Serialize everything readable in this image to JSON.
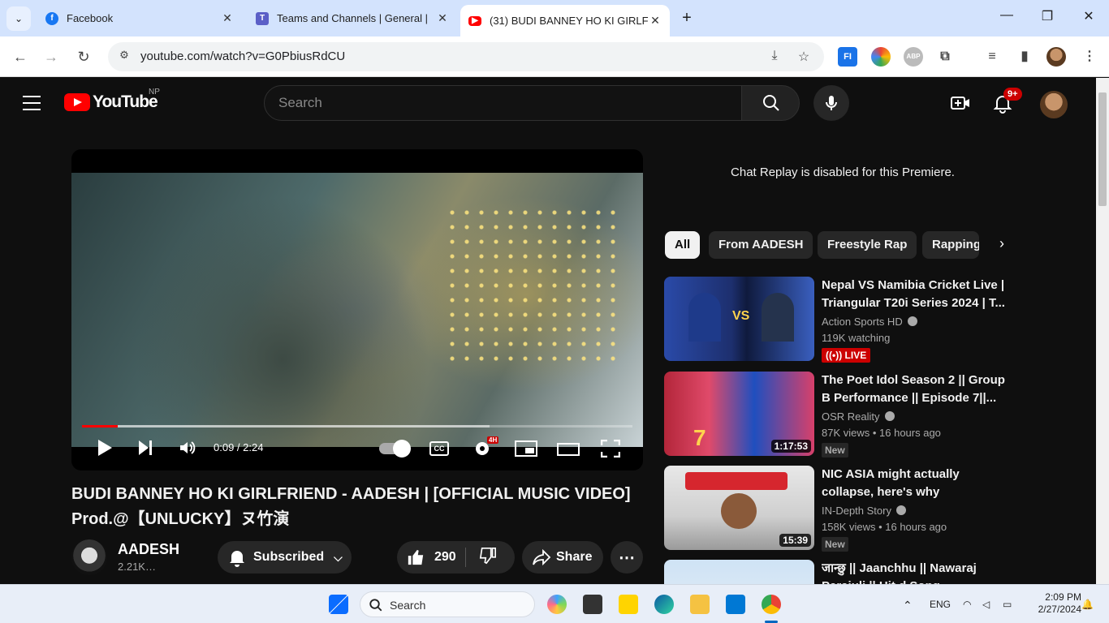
{
  "browser": {
    "tabs": [
      {
        "title": "Facebook",
        "favicon_color": "#1877f2"
      },
      {
        "title": "Teams and Channels | General |",
        "favicon_color": "#5b5fc7"
      },
      {
        "title": "(31) BUDI BANNEY HO KI GIRLF",
        "favicon_color": "#ff0000"
      }
    ],
    "url": "youtube.com/watch?v=G0PbiusRdCU",
    "extensions": [
      "FI",
      "ABP"
    ]
  },
  "yt": {
    "logo_text": "YouTube",
    "region": "NP",
    "search_placeholder": "Search",
    "notif_count": "9+",
    "accent": "#ff0000"
  },
  "player": {
    "time": "0:09 / 2:24",
    "quality_badge": "4H",
    "progress_fraction": 0.065,
    "buffered_fraction": 0.74
  },
  "video": {
    "title": "BUDI BANNEY HO KI GIRLFRIEND - AADESH | [OFFICIAL MUSIC VIDEO] Prod.@【UNLUCKY】ヌ竹演",
    "channel": "AADESH",
    "subs": "2.21K…",
    "subscribed_label": "Subscribed",
    "likes": "290",
    "share_label": "Share"
  },
  "sidebar": {
    "chat_replay": "Chat Replay is disabled for this Premiere.",
    "chips": [
      "All",
      "From AADESH",
      "Freestyle Rap",
      "Rapping"
    ],
    "recs": [
      {
        "title": "Nepal VS Namibia Cricket Live | Triangular T20i Series 2024 | T...",
        "channel": "Action Sports HD",
        "meta": "119K watching",
        "badge": "LIVE",
        "duration": ""
      },
      {
        "title": "The Poet Idol Season 2 || Group B Performance || Episode 7||...",
        "channel": "OSR Reality",
        "meta": "87K views • 16 hours ago",
        "badge": "New",
        "duration": "1:17:53"
      },
      {
        "title": "NIC ASIA might actually collapse, here's why",
        "channel": "IN-Depth Story",
        "meta": "158K views • 16 hours ago",
        "badge": "New",
        "duration": "15:39"
      },
      {
        "title": "जान्छु || Jaanchhu || Nawaraj Parajuli || Hit.d Song",
        "channel": "",
        "meta": "",
        "badge": "",
        "duration": ""
      }
    ]
  },
  "taskbar": {
    "search_label": "Search",
    "lang": "ENG",
    "time": "2:09 PM",
    "date": "2/27/2024"
  }
}
